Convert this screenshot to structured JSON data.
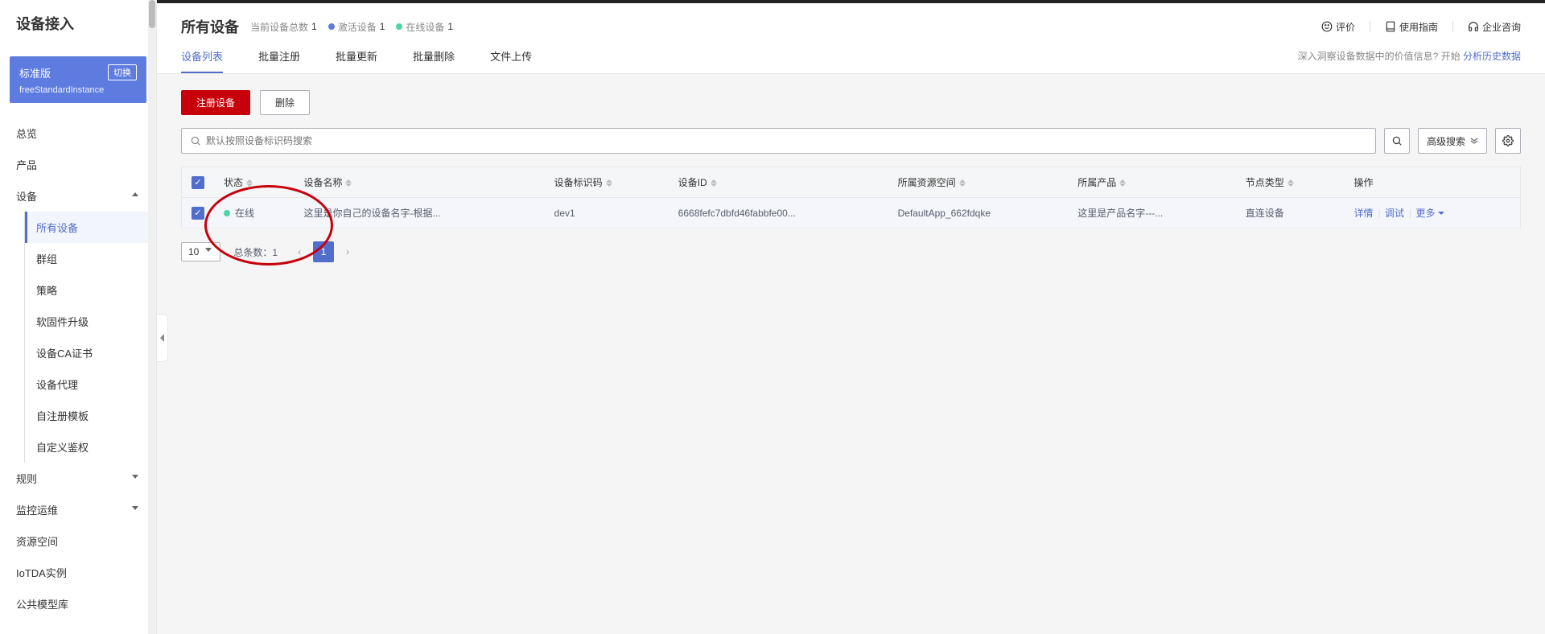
{
  "sidebar": {
    "title": "设备接入",
    "instance": {
      "name": "标准版",
      "switch": "切换",
      "sub": "freeStandardInstance"
    },
    "items": [
      {
        "label": "总览",
        "expand": null
      },
      {
        "label": "产品",
        "expand": null
      },
      {
        "label": "设备",
        "expand": "up",
        "children": [
          {
            "label": "所有设备",
            "active": true
          },
          {
            "label": "群组"
          },
          {
            "label": "策略"
          },
          {
            "label": "软固件升级"
          },
          {
            "label": "设备CA证书"
          },
          {
            "label": "设备代理"
          },
          {
            "label": "自注册模板"
          },
          {
            "label": "自定义鉴权"
          }
        ]
      },
      {
        "label": "规则",
        "expand": "down"
      },
      {
        "label": "监控运维",
        "expand": "down"
      },
      {
        "label": "资源空间",
        "expand": null
      },
      {
        "label": "IoTDA实例",
        "expand": null
      },
      {
        "label": "公共模型库",
        "expand": null
      }
    ]
  },
  "header": {
    "title": "所有设备",
    "stats": {
      "total_label": "当前设备总数",
      "total_value": "1",
      "active_label": "激活设备",
      "active_value": "1",
      "online_label": "在线设备",
      "online_value": "1"
    },
    "links": {
      "rate": "评价",
      "guide": "使用指南",
      "consult": "企业咨询"
    }
  },
  "tabs": [
    "设备列表",
    "批量注册",
    "批量更新",
    "批量删除",
    "文件上传"
  ],
  "hint": {
    "text": "深入洞察设备数据中的价值信息? 开始 ",
    "link": "分析历史数据"
  },
  "actions": {
    "register": "注册设备",
    "delete": "删除"
  },
  "search": {
    "placeholder": "默认按照设备标识码搜索",
    "adv": "高级搜索"
  },
  "table": {
    "headers": [
      "状态",
      "设备名称",
      "设备标识码",
      "设备ID",
      "所属资源空间",
      "所属产品",
      "节点类型",
      "操作"
    ],
    "rows": [
      {
        "status": "在线",
        "name": "这里是你自己的设备名字-根据...",
        "code": "dev1",
        "id": "6668fefc7dbfd46fabbfe00...",
        "space": "DefaultApp_662fdqke",
        "product": "这里是产品名字---...",
        "nodeType": "直连设备"
      }
    ],
    "row_actions": {
      "detail": "详情",
      "debug": "调试",
      "more": "更多"
    }
  },
  "pagination": {
    "pagesize": "10",
    "total_label": "总条数：",
    "total_value": "1",
    "page": "1"
  }
}
